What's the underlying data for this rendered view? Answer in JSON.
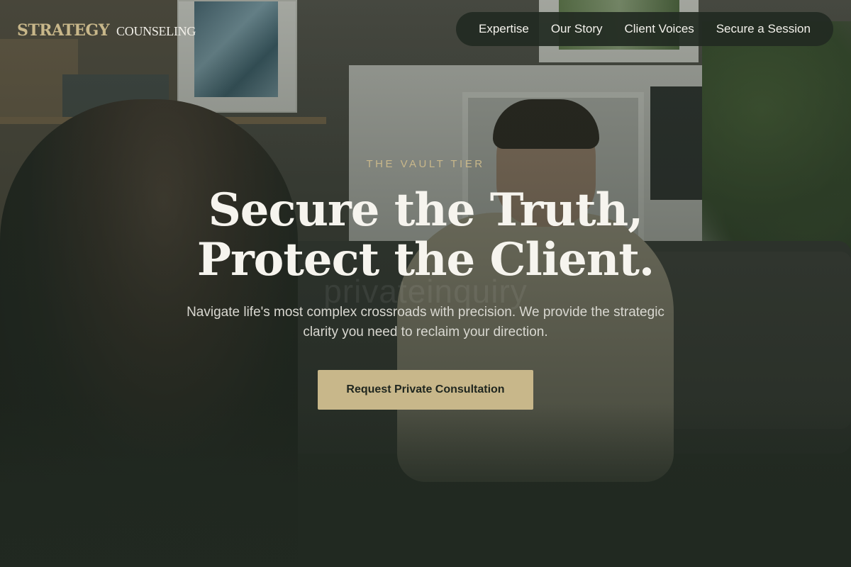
{
  "brand": {
    "primary": "STRATEGY",
    "secondary": "COUNSELING",
    "accent_color": "#c8b78a"
  },
  "nav": {
    "items": [
      {
        "label": "Expertise"
      },
      {
        "label": "Our Story"
      },
      {
        "label": "Client Voices"
      },
      {
        "label": "Secure a Session"
      }
    ]
  },
  "hero": {
    "eyebrow": "THE VAULT TIER",
    "title_line1": "Secure the Truth,",
    "title_line2": "Protect the Client.",
    "watermark": "privateinquiry",
    "subtitle": "Navigate life's most complex crossroads with precision. We provide the strategic clarity you need to reclaim your direction.",
    "cta_label": "Request Private Consultation"
  },
  "background": {
    "description_color": "#1f261f"
  }
}
